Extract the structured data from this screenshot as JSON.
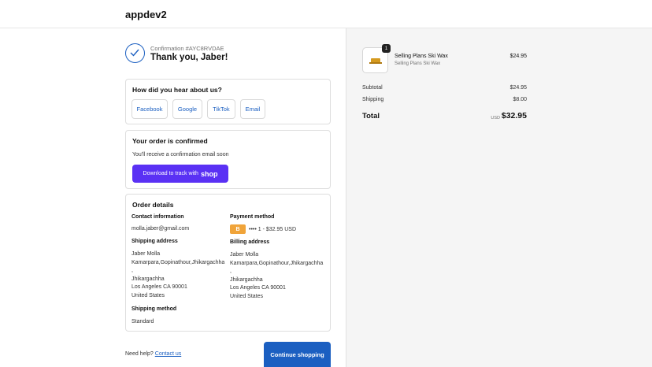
{
  "header": {
    "shop_name": "appdev2"
  },
  "confirmation": {
    "number_label": "Confirmation #AYC8RVDAE",
    "thank_you": "Thank you, Jaber!"
  },
  "survey": {
    "title": "How did you hear about us?",
    "options": [
      "Facebook",
      "Google",
      "TikTok",
      "Email"
    ]
  },
  "order_confirmed": {
    "title": "Your order is confirmed",
    "text": "You'll receive a confirmation email soon",
    "button_text": "Download to track with",
    "button_brand": "shop"
  },
  "order_details": {
    "title": "Order details",
    "contact_label": "Contact information",
    "contact_value": "molla.jaber@gmail.com",
    "payment_label": "Payment method",
    "payment_badge": "B",
    "payment_value": "•••• 1 - $32.95 USD",
    "shipping_address_label": "Shipping address",
    "shipping_address": [
      "Jaber Molla",
      "Kamarpara,Gopinathour,Jhikargachha",
      ",",
      "Jhikargachha",
      "Los Angeles CA 90001",
      "United States"
    ],
    "billing_address_label": "Billing address",
    "billing_address": [
      "Jaber Molla",
      "Kamarpara,Gopinathour,Jhikargachha",
      ",",
      "Jhikargachha",
      "Los Angeles CA 90001",
      "United States"
    ],
    "shipping_method_label": "Shipping method",
    "shipping_method": "Standard"
  },
  "footer": {
    "need_help": "Need help?",
    "contact_link": "Contact us",
    "continue_button": "Continue shopping"
  },
  "summary": {
    "product": {
      "name": "Selling Plans Ski Wax",
      "variant": "Selling Plans Ski Wax",
      "price": "$24.95",
      "quantity": "1"
    },
    "subtotal_label": "Subtotal",
    "subtotal": "$24.95",
    "shipping_label": "Shipping",
    "shipping": "$8.00",
    "total_label": "Total",
    "currency": "USD",
    "total": "$32.95"
  },
  "colors": {
    "accent": "#1b5fc1",
    "shop_pay": "#5a31f4",
    "payment_badge": "#f0a43a"
  }
}
